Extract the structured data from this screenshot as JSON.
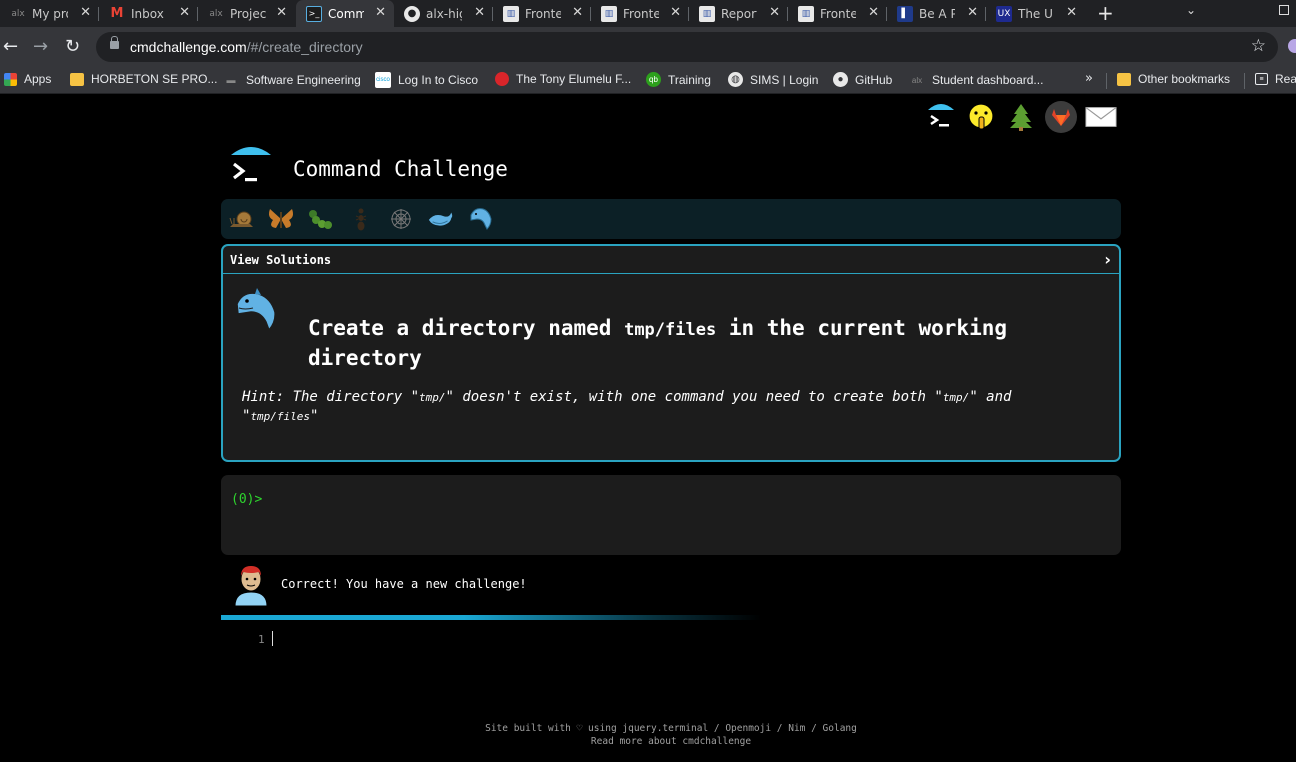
{
  "browser": {
    "tabs": [
      {
        "title": "My pro",
        "fav": "alx-icon",
        "active": false
      },
      {
        "title": "Inbox (",
        "fav": "gmail-icon",
        "active": false
      },
      {
        "title": "Projec",
        "fav": "alx-icon",
        "active": false
      },
      {
        "title": "Comm",
        "fav": "terminal-icon",
        "active": true
      },
      {
        "title": "alx-hig",
        "fav": "github-icon",
        "active": false
      },
      {
        "title": "Fronte",
        "fav": "doc-icon",
        "active": false
      },
      {
        "title": "Fronte",
        "fav": "doc-icon",
        "active": false
      },
      {
        "title": "Report",
        "fav": "doc-icon",
        "active": false
      },
      {
        "title": "Fronte",
        "fav": "doc-icon",
        "active": false
      },
      {
        "title": "Be A P",
        "fav": "blue-doc-icon",
        "active": false
      },
      {
        "title": "The UI",
        "fav": "ux-icon",
        "active": false
      }
    ],
    "url": {
      "domain": "cmdchallenge.com",
      "path": "/#/create_directory"
    },
    "bookmarks": [
      {
        "label": "Apps",
        "icon": "apps-grid-icon"
      },
      {
        "label": "HORBETON SE PRO...",
        "icon": "folder-icon"
      },
      {
        "label": "Software Engineering",
        "icon": "bookmark-icon"
      },
      {
        "label": "Log In to Cisco",
        "icon": "cisco-icon"
      },
      {
        "label": "The Tony Elumelu F...",
        "icon": "tef-icon"
      },
      {
        "label": "Training",
        "icon": "qb-icon"
      },
      {
        "label": "SIMS | Login",
        "icon": "globe-icon"
      },
      {
        "label": "GitHub",
        "icon": "github-icon"
      },
      {
        "label": "Student dashboard...",
        "icon": "alx-icon"
      }
    ],
    "other_bookmarks": "Other bookmarks",
    "reading_list": "Rea",
    "more": "»",
    "ux_fav_text": "UX"
  },
  "page": {
    "site_title": "Command Challenge",
    "view_solutions": "View Solutions",
    "challenge": {
      "title_pre": "Create a directory named ",
      "title_code": "tmp/files",
      "title_post": " in the current working directory",
      "hint_pre": "Hint: The directory \"",
      "hint_code1": "tmp/",
      "hint_mid1": "\" doesn't exist, with one command you need to create both \"",
      "hint_code2": "tmp/",
      "hint_mid2": "\" and \"",
      "hint_code3": "tmp/files",
      "hint_end": "\""
    },
    "prompt": "(0)>",
    "status_message": "Correct! You have a new challenge!",
    "progress_fraction": 0.45,
    "editor_line_number": "1",
    "footer": {
      "line1": "Site built with ♡ using jquery.terminal / Openmoji / Nim / Golang",
      "line2": "Read more about cmdchallenge"
    }
  }
}
